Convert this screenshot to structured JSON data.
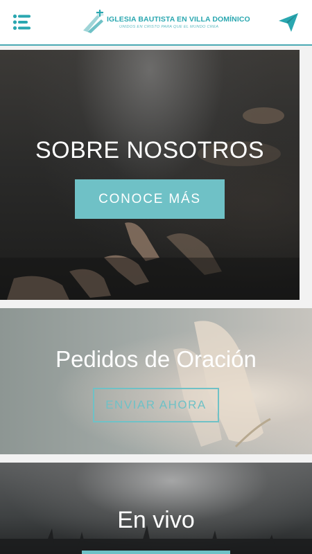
{
  "header": {
    "menu_icon": "menu-list-icon",
    "logo": {
      "title": "IGLESIA BAUTISTA EN VILLA DOMÍNICO",
      "subtitle": "UNIDOS EN CRISTO PARA QUE EL MUNDO CREA"
    },
    "send_icon": "paper-plane-icon"
  },
  "cards": {
    "about": {
      "title": "SOBRE NOSOTROS",
      "button_label": "CONOCE MÁS"
    },
    "prayer": {
      "title": "Pedidos de Oración",
      "button_label": "ENVIAR AHORA"
    },
    "live": {
      "title": "En vivo"
    }
  },
  "colors": {
    "accent": "#6fc1c6",
    "logo_teal": "#2aa7b0",
    "header_bg": "#ffffff",
    "page_bg": "#f2f2f2"
  }
}
